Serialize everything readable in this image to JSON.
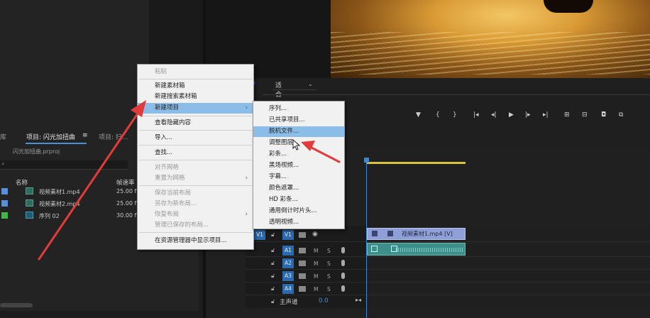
{
  "project_panel": {
    "tab_partial": "库",
    "tab_active": "项目: 闪光加扭曲",
    "tab_menu_icon": "≡",
    "tab_other": "项目: 扫...",
    "file_name": "闪光加扭曲.prproj",
    "columns": {
      "name": "名称",
      "fps": "帧速率"
    },
    "items": [
      {
        "name": "视频素材1.mp4",
        "fps": "25.00 fps",
        "color": "#5b8fd4",
        "icon": "video-file-icon"
      },
      {
        "name": "视频素材2.mp4",
        "fps": "25.00 fps",
        "color": "#5b8fd4",
        "icon": "video-file-icon"
      },
      {
        "name": "序列 02",
        "fps": "30.00 fps",
        "color": "#44b24d",
        "icon": "sequence-icon"
      }
    ]
  },
  "program_monitor": {
    "timecode_tail": "0",
    "fit_label": "适合"
  },
  "context_menu": {
    "items": [
      {
        "label": "粘贴",
        "disabled": true
      },
      {
        "label": "新建素材箱",
        "disabled": false
      },
      {
        "label": "新建搜索素材箱",
        "disabled": false
      },
      {
        "label": "新建项目",
        "disabled": false,
        "highlighted": true,
        "submenu": true
      },
      {
        "label": "查看隐藏内容",
        "disabled": false
      },
      {
        "label": "导入...",
        "disabled": false
      },
      {
        "label": "查找...",
        "disabled": false
      },
      {
        "label": "对齐网格",
        "disabled": true
      },
      {
        "label": "重置为网格",
        "disabled": true,
        "submenu": true
      },
      {
        "label": "保存当前布局",
        "disabled": true
      },
      {
        "label": "另存为新布局...",
        "disabled": true
      },
      {
        "label": "恢复布局",
        "disabled": true,
        "submenu": true
      },
      {
        "label": "管理已保存的布局...",
        "disabled": true
      },
      {
        "label": "在资源管理器中显示项目...",
        "disabled": false
      }
    ]
  },
  "submenu": {
    "items": [
      {
        "label": "序列..."
      },
      {
        "label": "已共享项目..."
      },
      {
        "label": "脱机文件...",
        "highlighted": true
      },
      {
        "label": "调整图层..."
      },
      {
        "label": "彩条..."
      },
      {
        "label": "黑场视频..."
      },
      {
        "label": "字幕..."
      },
      {
        "label": "颜色遮罩..."
      },
      {
        "label": "HD 彩条..."
      },
      {
        "label": "通用倒计时片头..."
      },
      {
        "label": "透明视频..."
      }
    ]
  },
  "timeline": {
    "source_v1": "V1",
    "tracks": [
      "V1",
      "A1",
      "A2",
      "A3",
      "A4"
    ],
    "mute_label": "M",
    "solo_label": "S",
    "clip_v1_label": "视频素材1.mp4 [V]",
    "master_label": "主声道",
    "master_value": "0.0"
  },
  "colors": {
    "accent_blue": "#4a90d9",
    "menu_highlight": "#8cbde8",
    "arrow_red": "#e23b3b",
    "clip_video": "#8fa0d8",
    "clip_audio": "#3e8f8b"
  }
}
